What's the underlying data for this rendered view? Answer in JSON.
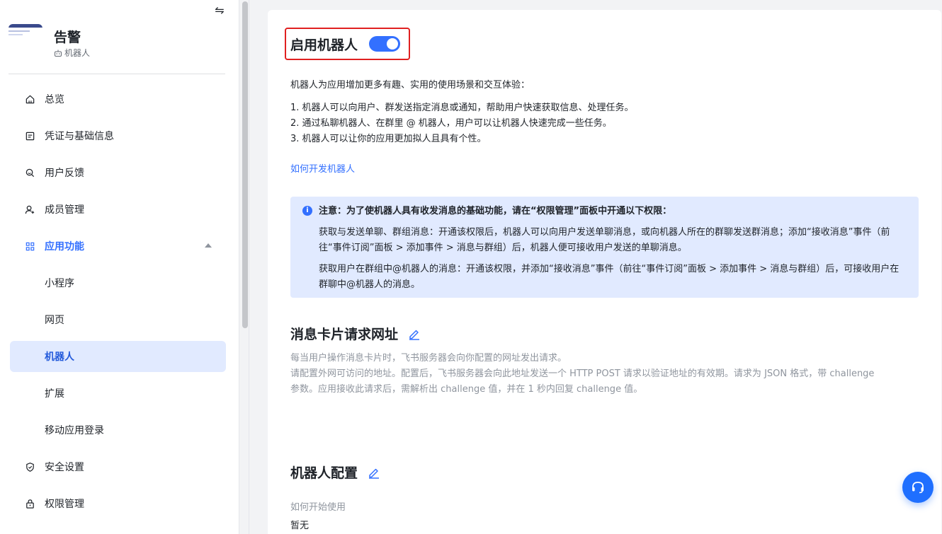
{
  "app": {
    "name": "告警",
    "subtitle": "机器人"
  },
  "sidebar": {
    "items": [
      {
        "label": "总览",
        "icon": "home-icon"
      },
      {
        "label": "凭证与基础信息",
        "icon": "credential-icon"
      },
      {
        "label": "用户反馈",
        "icon": "feedback-icon"
      },
      {
        "label": "成员管理",
        "icon": "add-member-icon"
      },
      {
        "label": "应用功能",
        "icon": "grid-icon"
      },
      {
        "label": "小程序"
      },
      {
        "label": "网页"
      },
      {
        "label": "机器人"
      },
      {
        "label": "扩展"
      },
      {
        "label": "移动应用登录"
      },
      {
        "label": "安全设置",
        "icon": "shield-icon"
      },
      {
        "label": "权限管理",
        "icon": "lock-icon"
      }
    ]
  },
  "main": {
    "robot_title": "启用机器人",
    "toggle_on": true,
    "intro": "机器人为应用增加更多有趣、实用的使用场景和交互体验：",
    "points": [
      "1. 机器人可以向用户、群发送指定消息或通知，帮助用户快速获取信息、处理任务。",
      "2. 通过私聊机器人、在群里 @ 机器人，用户可以让机器人快速完成一些任务。",
      "3. 机器人可以让你的应用更加拟人且具有个性。"
    ],
    "link": "如何开发机器人",
    "notice": {
      "title": "注意：为了使机器人具有收发消息的基础功能，请在“权限管理”面板中开通以下权限：",
      "para1": "获取与发送单聊、群组消息：开通该权限后，机器人可以向用户发送单聊消息，或向机器人所在的群聊发送群消息；添加“接收消息”事件（前往“事件订阅”面板 > 添加事件 > 消息与群组）后，机器人便可接收用户发送的单聊消息。",
      "para2": "获取用户在群组中@机器人的消息：开通该权限，并添加“接收消息”事件（前往“事件订阅”面板 > 添加事件 > 消息与群组）后，可接收用户在群聊中@机器人的消息。"
    },
    "card_section": {
      "title": "消息卡片请求网址",
      "desc1": "每当用户操作消息卡片时，飞书服务器会向你配置的网址发出请求。",
      "desc2": "请配置外网可访问的地址。配置后，飞书服务器会向此地址发送一个 HTTP POST 请求以验证地址的有效期。请求为 JSON 格式，带 challenge 参数。应用接收此请求后，需解析出 challenge 值，并在 1 秒内回复 challenge 值。"
    },
    "config_section": {
      "title": "机器人配置",
      "field_label": "如何开始使用",
      "field_value": "暂无"
    }
  },
  "colors": {
    "accent": "#3370ff",
    "notice_bg": "#e1eaff",
    "highlight_border": "#e02020"
  }
}
